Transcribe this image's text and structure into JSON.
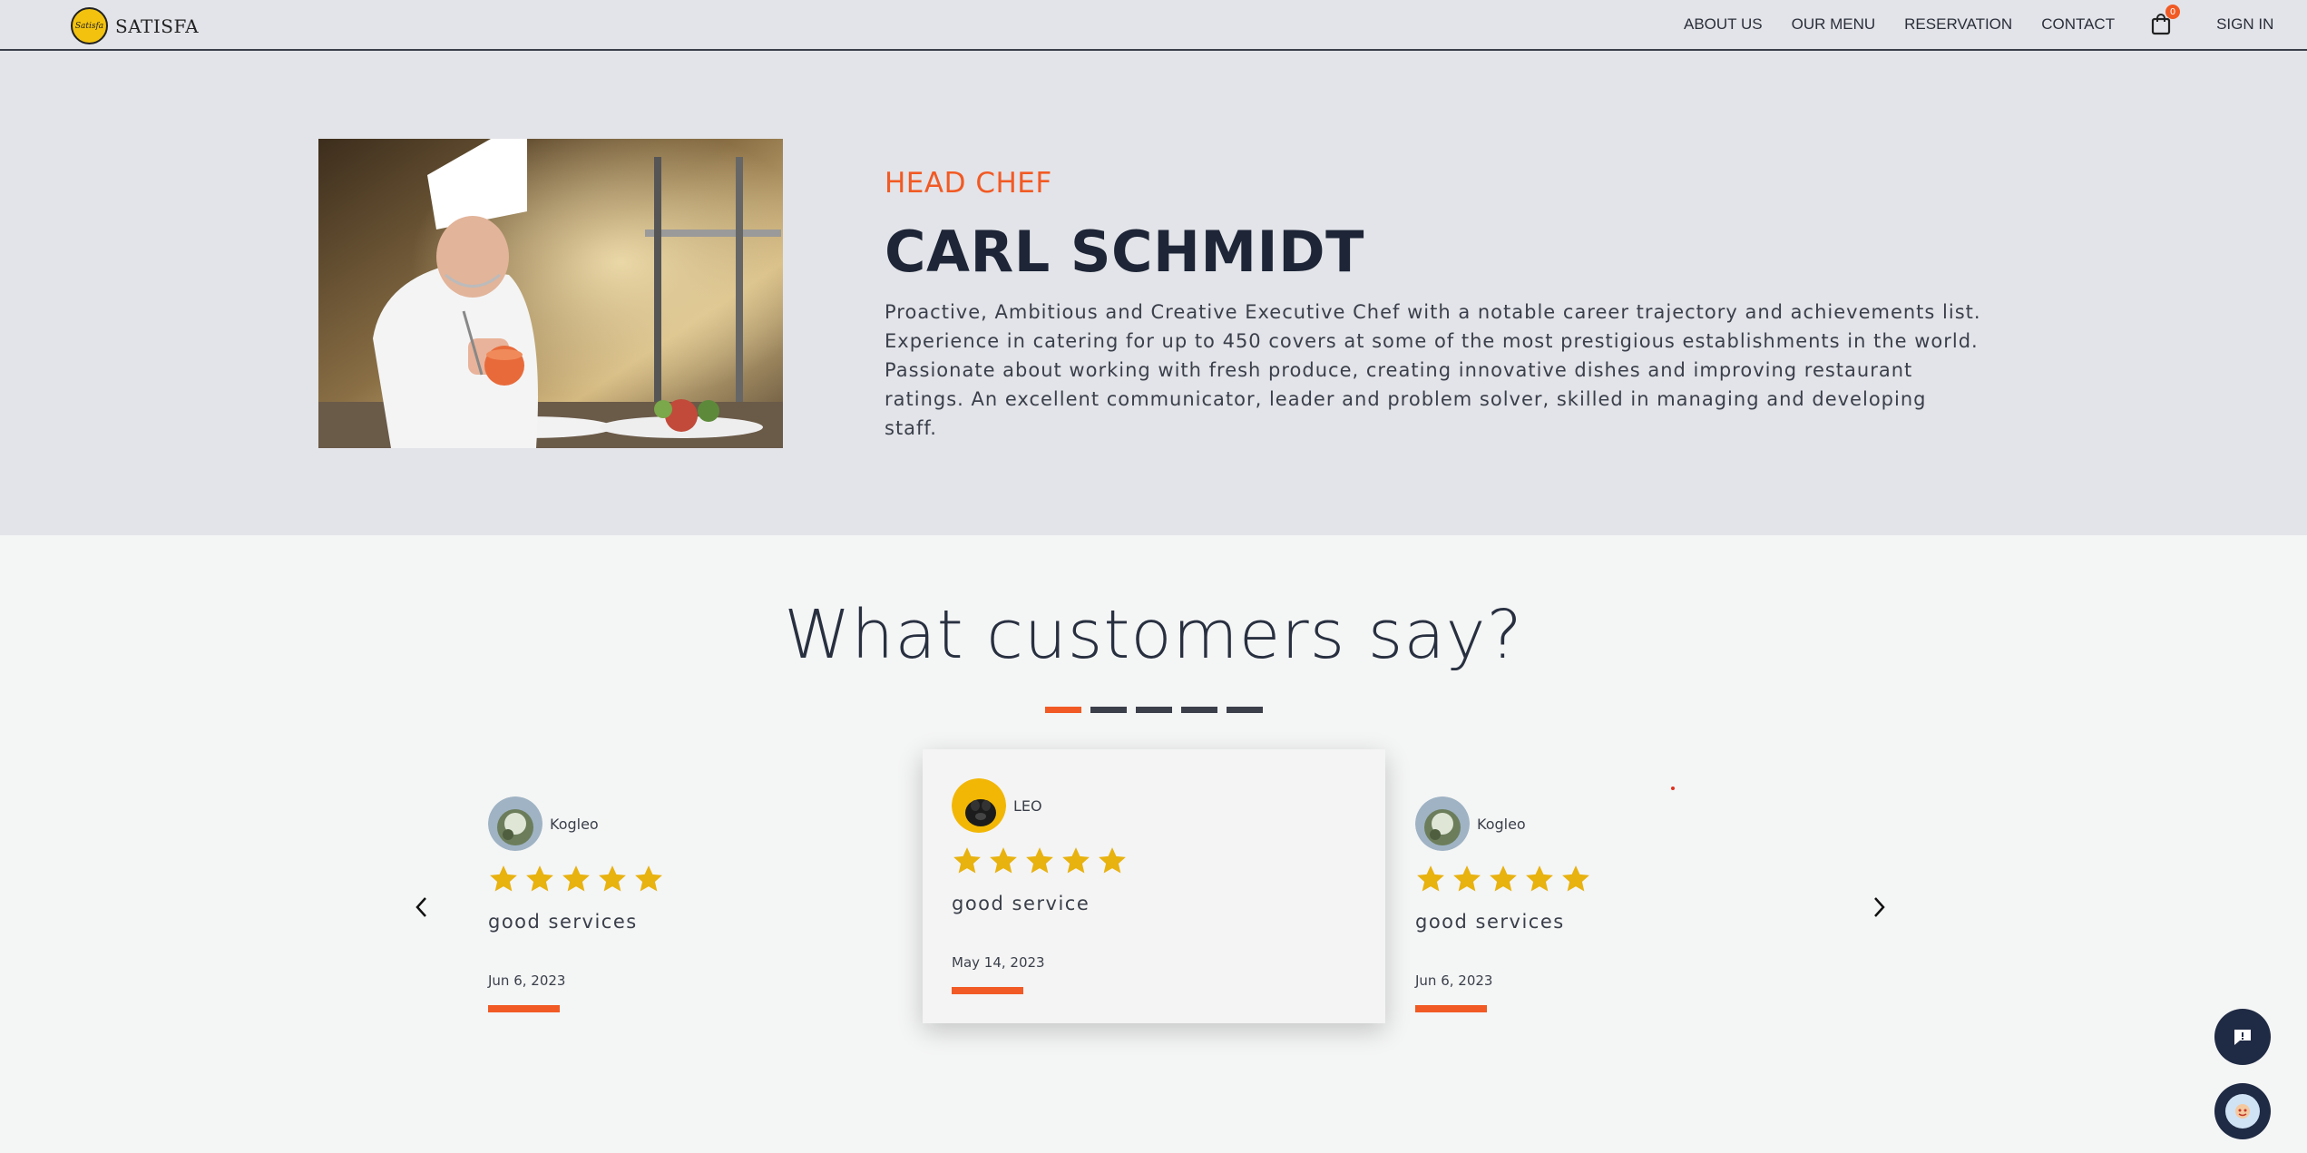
{
  "navbar": {
    "logo_badge": "Satisfa",
    "brand": "SATISFA",
    "links": [
      "ABOUT US",
      "OUR MENU",
      "RESERVATION",
      "CONTACT"
    ],
    "cart_count": "0",
    "sign_in": "SIGN IN"
  },
  "chef": {
    "role": "HEAD CHEF",
    "name": "CARL SCHMIDT",
    "bio": "Proactive, Ambitious and Creative Executive Chef with a notable career trajectory and achievements list. Experience in catering for up to 450 covers at some of the most prestigious establishments in the world. Passionate about working with fresh produce, creating innovative dishes and improving restaurant ratings. An excellent communicator, leader and problem solver, skilled in managing and developing staff."
  },
  "testimonials": {
    "title": "What customers say?",
    "active_page": 1,
    "page_count": 5,
    "cards": [
      {
        "user": "Kogleo",
        "rating": 5,
        "review": "good services",
        "date": "Jun 6, 2023"
      },
      {
        "user": "LEO",
        "rating": 5,
        "review": "good service",
        "date": "May 14, 2023"
      },
      {
        "user": "Kogleo",
        "rating": 5,
        "review": "good services",
        "date": "Jun 6, 2023"
      }
    ]
  },
  "colors": {
    "accent": "#f15a24",
    "star": "#e8b20f",
    "dark_navy": "#1f2a44",
    "nav_bg": "#e3e4e9"
  },
  "icons": {
    "cart": "shopping-bag-icon",
    "prev": "chevron-left-icon",
    "next": "chevron-right-icon",
    "chat": "chat-bubble-icon",
    "assistant": "assistant-icon"
  }
}
